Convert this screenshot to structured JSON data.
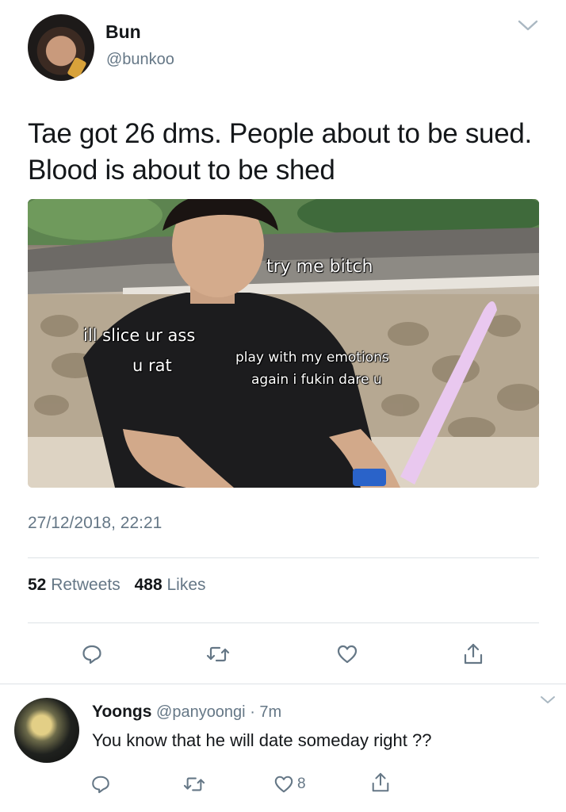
{
  "tweet": {
    "author_name": "Bun",
    "author_handle": "@bunkoo",
    "text": "Tae got 26 dms. People about to be sued. Blood is about to be shed",
    "media": {
      "captions": [
        "try me bitch",
        "ill slice ur ass",
        "u rat",
        "play with my emotions",
        "again i fukin dare u"
      ]
    },
    "timestamp": "27/12/2018, 22:21",
    "retweets_count": "52",
    "retweets_label": "Retweets",
    "likes_count": "488",
    "likes_label": "Likes",
    "actions": [
      "reply-icon",
      "retweet-icon",
      "like-icon",
      "share-icon"
    ]
  },
  "reply": {
    "author_name": "Yoongs",
    "author_handle": "@panyoongi",
    "separator": "·",
    "time": "7m",
    "text": "You know that he will date someday right ??",
    "like_count": "8",
    "actions": [
      "reply-icon",
      "retweet-icon",
      "like-icon",
      "share-icon"
    ]
  },
  "colors": {
    "text": "#14171a",
    "secondary": "#657786",
    "divider": "#dde2e6",
    "icon": "#657786"
  }
}
